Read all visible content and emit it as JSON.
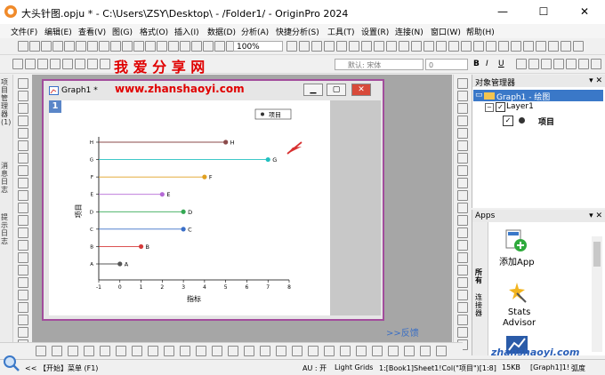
{
  "window": {
    "title": "大头针图.opju * - C:\\Users\\ZSY\\Desktop\\ - /Folder1/ - OriginPro 2024",
    "minimize": "—",
    "maximize": "☐",
    "close": "✕"
  },
  "menu": [
    "文件(F)",
    "编辑(E)",
    "查看(V)",
    "图(G)",
    "格式(O)",
    "插入(I)",
    "数据(D)",
    "分析(A)",
    "快捷分析(S)",
    "工具(T)",
    "设置(R)",
    "连接(N)",
    "窗口(W)",
    "帮助(H)"
  ],
  "toolbar": {
    "zoom": "100%",
    "font": "默认: 宋体",
    "fontsize": "0",
    "bold": "B",
    "italic": "I",
    "underline": "U"
  },
  "watermark": {
    "title": "我 爱 分 享 网",
    "url": "www.zhanshaoyi.com",
    "corner": "zhanshaoyi.com"
  },
  "left_panel_tabs": [
    "项目管理器 (1)",
    "消息日志",
    "提示日志"
  ],
  "graph_window": {
    "title": "Graph1 *",
    "layer": "1",
    "legend": "项目",
    "feedback": ">>反馈"
  },
  "chart_data": {
    "type": "scatter",
    "style": "lollipop",
    "categories": [
      "A",
      "B",
      "C",
      "D",
      "E",
      "F",
      "G",
      "H"
    ],
    "values": [
      0,
      1,
      3,
      3,
      2,
      4,
      7,
      5
    ],
    "colors": [
      "#555555",
      "#d63a3a",
      "#3a6fc8",
      "#34a853",
      "#b56ad6",
      "#e0a020",
      "#22c0c0",
      "#8b4a4a"
    ],
    "xlabel": "指标",
    "ylabel": "项目",
    "xlim": [
      -1,
      8
    ],
    "xticks": [
      -1,
      0,
      1,
      2,
      3,
      4,
      5,
      6,
      7,
      8
    ],
    "legend": "top-right"
  },
  "object_manager": {
    "title": "对象管理器",
    "pin": "▾ ✕",
    "graph": "Graph1 - 绘图",
    "layer": "Layer1",
    "item": "项目"
  },
  "apps": {
    "title": "Apps",
    "pin": "▾ ✕",
    "tab_all": "所有",
    "tab_group": "连接器",
    "items": [
      {
        "label": "添加App"
      },
      {
        "label": "Stats\nAdvisor"
      }
    ]
  },
  "statusbar": {
    "start": "<< 【开始】菜单 (F1)",
    "au": "AU : 开",
    "grids": "Light Grids",
    "data": "1:[Book1]Sheet1!Col(\"项目\")[1:8]",
    "size": "15KB",
    "graph": "[Graph1]1!",
    "unit": "弧度"
  }
}
